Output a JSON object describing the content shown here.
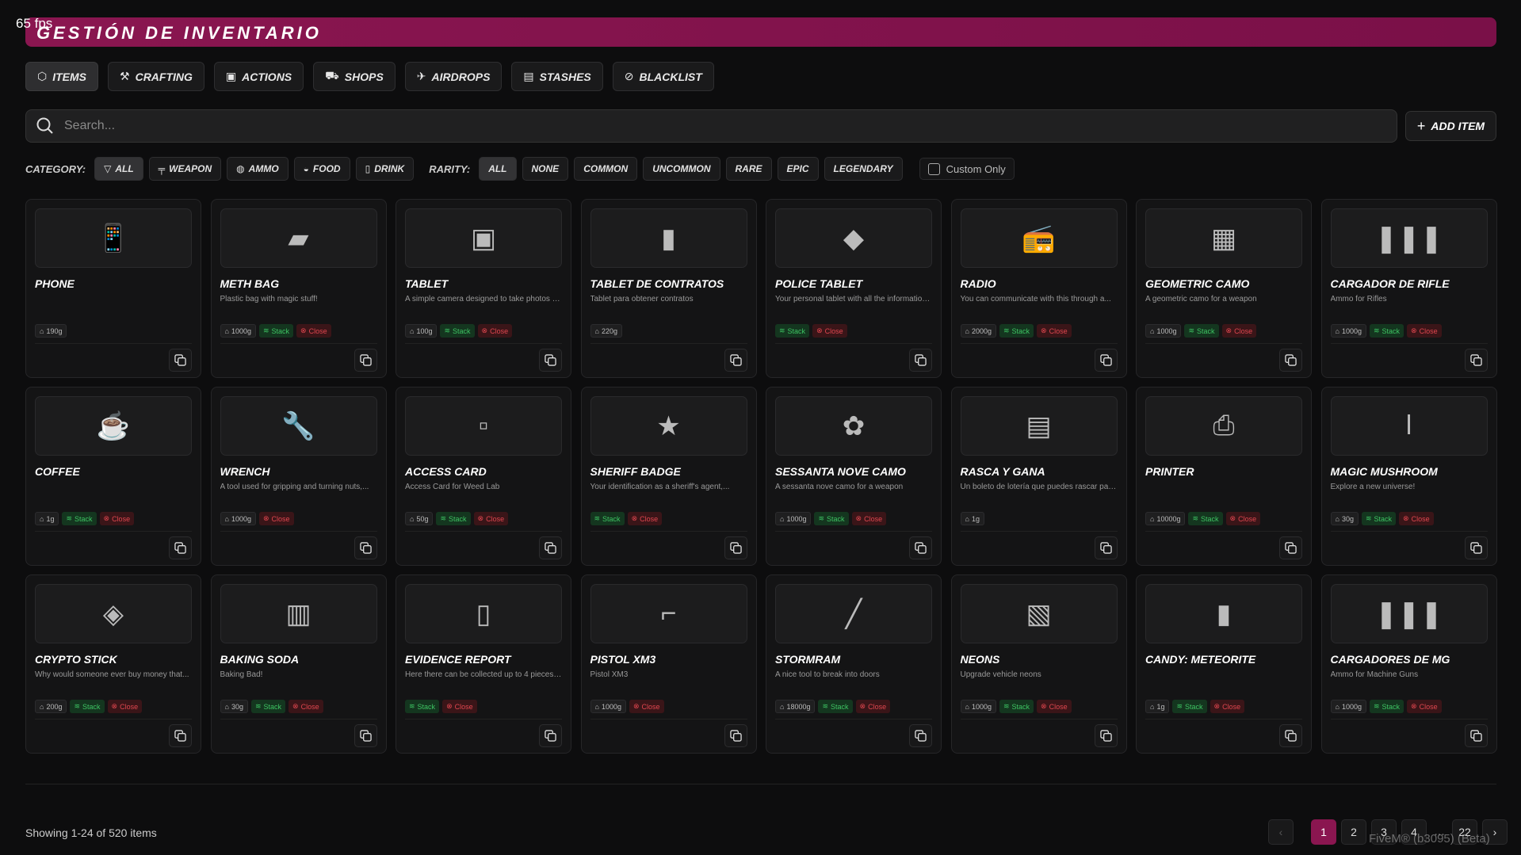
{
  "overlay": {
    "fps": "65 fps",
    "watermark": "FiveM® (b3095) (Beta)"
  },
  "header": {
    "title": "GESTIÓN DE INVENTARIO",
    "accent": "#8a1650"
  },
  "tabs": [
    {
      "label": "ITEMS",
      "icon": "cube-icon",
      "active": true
    },
    {
      "label": "CRAFTING",
      "icon": "hammer-icon"
    },
    {
      "label": "ACTIONS",
      "icon": "briefcase-icon"
    },
    {
      "label": "SHOPS",
      "icon": "cart-icon"
    },
    {
      "label": "AIRDROPS",
      "icon": "plane-icon"
    },
    {
      "label": "STASHES",
      "icon": "archive-icon"
    },
    {
      "label": "BLACKLIST",
      "icon": "ban-icon"
    }
  ],
  "search": {
    "placeholder": "Search...",
    "value": ""
  },
  "add_item": "ADD ITEM",
  "filters": {
    "category_label": "CATEGORY:",
    "categories": [
      {
        "label": "ALL",
        "icon": "filter-icon",
        "active": true
      },
      {
        "label": "WEAPON",
        "icon": "gun-icon"
      },
      {
        "label": "AMMO",
        "icon": "ammo-icon"
      },
      {
        "label": "FOOD",
        "icon": "burger-icon"
      },
      {
        "label": "DRINK",
        "icon": "cup-icon"
      }
    ],
    "rarity_label": "RARITY:",
    "rarities": [
      {
        "label": "ALL",
        "active": true
      },
      {
        "label": "NONE"
      },
      {
        "label": "COMMON"
      },
      {
        "label": "UNCOMMON"
      },
      {
        "label": "RARE"
      },
      {
        "label": "EPIC"
      },
      {
        "label": "LEGENDARY"
      }
    ],
    "custom_only": "Custom Only"
  },
  "badge_labels": {
    "stack": "Stack",
    "close": "Close"
  },
  "items": [
    {
      "name": "PHONE",
      "desc": "",
      "weight": "190g",
      "stack": false,
      "close": false,
      "glyph": "📱"
    },
    {
      "name": "METH BAG",
      "desc": "Plastic bag with magic stuff!",
      "weight": "1000g",
      "stack": true,
      "close": true,
      "glyph": "▰"
    },
    {
      "name": "TABLET",
      "desc": "A simple camera designed to take photos at ...",
      "weight": "100g",
      "stack": true,
      "close": true,
      "glyph": "▣"
    },
    {
      "name": "TABLET DE CONTRATOS",
      "desc": "Tablet para obtener contratos",
      "weight": "220g",
      "stack": false,
      "close": false,
      "glyph": "▮"
    },
    {
      "name": "POLICE TABLET",
      "desc": "Your personal tablet with all the information o...",
      "weight": "",
      "stack": true,
      "close": true,
      "glyph": "◆"
    },
    {
      "name": "RADIO",
      "desc": "You can communicate with this through a...",
      "weight": "2000g",
      "stack": true,
      "close": true,
      "glyph": "📻"
    },
    {
      "name": "GEOMETRIC CAMO",
      "desc": "A geometric camo for a weapon",
      "weight": "1000g",
      "stack": true,
      "close": true,
      "glyph": "▦"
    },
    {
      "name": "CARGADOR DE RIFLE",
      "desc": "Ammo for Rifles",
      "weight": "1000g",
      "stack": true,
      "close": true,
      "glyph": "❚❚❚"
    },
    {
      "name": "COFFEE",
      "desc": "",
      "weight": "1g",
      "stack": true,
      "close": true,
      "glyph": "☕"
    },
    {
      "name": "WRENCH",
      "desc": "A tool used for gripping and turning nuts,...",
      "weight": "1000g",
      "stack": false,
      "close": true,
      "glyph": "🔧"
    },
    {
      "name": "ACCESS CARD",
      "desc": "Access Card for Weed Lab",
      "weight": "50g",
      "stack": true,
      "close": true,
      "glyph": "▫"
    },
    {
      "name": "SHERIFF BADGE",
      "desc": "Your identification as a sheriff's agent,...",
      "weight": "",
      "stack": true,
      "close": true,
      "glyph": "★"
    },
    {
      "name": "SESSANTA NOVE CAMO",
      "desc": "A sessanta nove camo for a weapon",
      "weight": "1000g",
      "stack": true,
      "close": true,
      "glyph": "✿"
    },
    {
      "name": "RASCA Y GANA",
      "desc": "Un boleto de lotería que puedes rascar para...",
      "weight": "1g",
      "stack": false,
      "close": false,
      "glyph": "▤"
    },
    {
      "name": "PRINTER",
      "desc": "",
      "weight": "10000g",
      "stack": true,
      "close": true,
      "glyph": "⎙"
    },
    {
      "name": "MAGIC MUSHROOM",
      "desc": "Explore a new universe!",
      "weight": "30g",
      "stack": true,
      "close": true,
      "glyph": "ǀ"
    },
    {
      "name": "CRYPTO STICK",
      "desc": "Why would someone ever buy money that...",
      "weight": "200g",
      "stack": true,
      "close": true,
      "glyph": "◈"
    },
    {
      "name": "BAKING SODA",
      "desc": "Baking Bad!",
      "weight": "30g",
      "stack": true,
      "close": true,
      "glyph": "▥"
    },
    {
      "name": "EVIDENCE REPORT",
      "desc": "Here there can be collected up to 4 pieces of...",
      "weight": "",
      "stack": true,
      "close": true,
      "glyph": "▯"
    },
    {
      "name": "PISTOL XM3",
      "desc": "Pistol XM3",
      "weight": "1000g",
      "stack": false,
      "close": true,
      "glyph": "⌐"
    },
    {
      "name": "STORMRAM",
      "desc": "A nice tool to break into doors",
      "weight": "18000g",
      "stack": true,
      "close": true,
      "glyph": "╱"
    },
    {
      "name": "NEONS",
      "desc": "Upgrade vehicle neons",
      "weight": "1000g",
      "stack": true,
      "close": true,
      "glyph": "▧"
    },
    {
      "name": "CANDY: METEORITE",
      "desc": "",
      "weight": "1g",
      "stack": true,
      "close": true,
      "glyph": "▮"
    },
    {
      "name": "CARGADORES DE MG",
      "desc": "Ammo for Machine Guns",
      "weight": "1000g",
      "stack": true,
      "close": true,
      "glyph": "❚❚❚"
    }
  ],
  "footer": {
    "showing": "Showing 1-24 of 520 items",
    "pages": [
      "1",
      "2",
      "3",
      "4",
      "...",
      "22"
    ],
    "current_page": "1",
    "prev": "‹",
    "next": "›"
  }
}
